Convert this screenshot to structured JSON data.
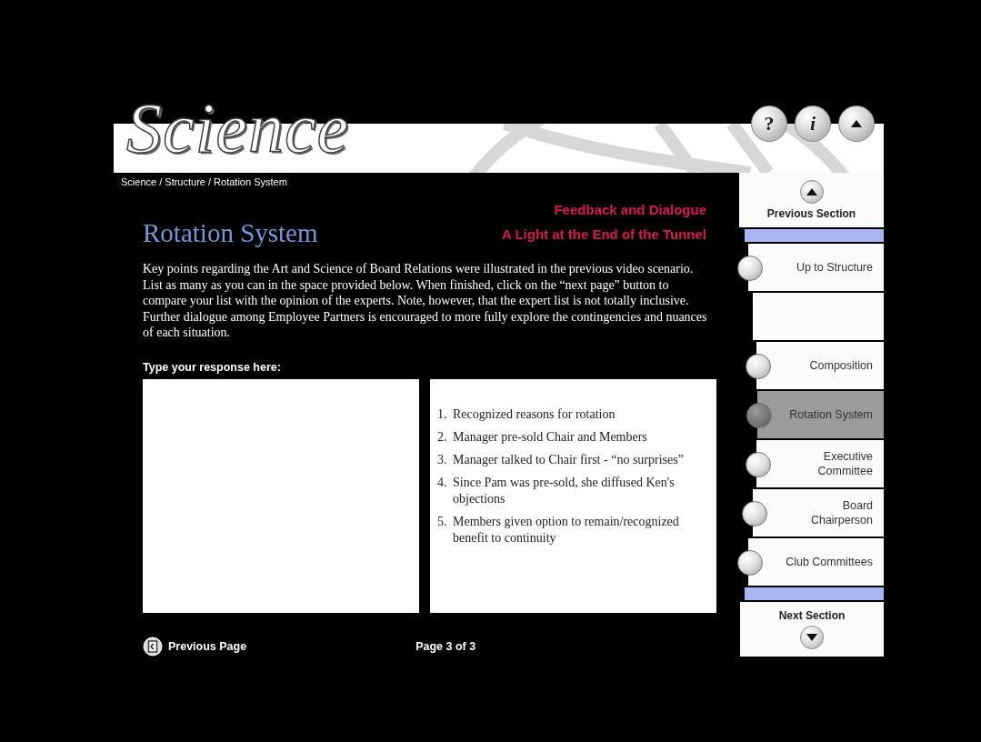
{
  "header": {
    "logo": "Science",
    "buttons": [
      {
        "kind": "help",
        "label": "?"
      },
      {
        "kind": "info",
        "label": "i"
      },
      {
        "kind": "home"
      }
    ]
  },
  "breadcrumb": "Science / Structure / Rotation System",
  "title": "Rotation System",
  "subtitles": [
    "Feedback and Dialogue",
    "A Light at the End of the Tunnel"
  ],
  "intro": "Key points regarding the Art and Science of Board Relations were illustrated in the previous video scenario.  List as many as you can in the space provided below.  When finished, click on the “next page” button to compare your list with the opinion of the experts.  Note, however, that the expert list is not totally inclusive.  Further dialogue among Employee Partners is encouraged to more fully explore the contingencies and nuances of each situation.",
  "response": {
    "label": "Type your response here:"
  },
  "expert_list": [
    {
      "number": "1.",
      "text": "Recognized reasons for rotation"
    },
    {
      "number": "2.",
      "text": "Manager pre-sold Chair and Members"
    },
    {
      "number": "3.",
      "text": "Manager talked to Chair first - “no surprises”"
    },
    {
      "number": "4.",
      "text": "Since Pam was pre-sold, she diffused Ken's objections"
    },
    {
      "number": "5.",
      "text": "Members given option to remain/recognized benefit to continuity"
    }
  ],
  "footer": {
    "previous": "Previous Page",
    "page": "Page 3 of 3"
  },
  "sidebar": [
    {
      "kind": "previous",
      "label": "Previous Section"
    },
    {
      "kind": "divider"
    },
    {
      "kind": "nav",
      "label": "Up to Structure",
      "selected": false
    },
    {
      "kind": "blank"
    },
    {
      "kind": "nav",
      "label": "Composition",
      "selected": false
    },
    {
      "kind": "nav",
      "label": "Rotation System",
      "selected": true
    },
    {
      "kind": "nav",
      "label": "Executive Committee",
      "selected": false
    },
    {
      "kind": "nav",
      "label": "Board Chairperson",
      "selected": false
    },
    {
      "kind": "nav",
      "label": "Club Committees",
      "selected": false
    },
    {
      "kind": "divider"
    },
    {
      "kind": "next",
      "label": "Next Section"
    }
  ]
}
